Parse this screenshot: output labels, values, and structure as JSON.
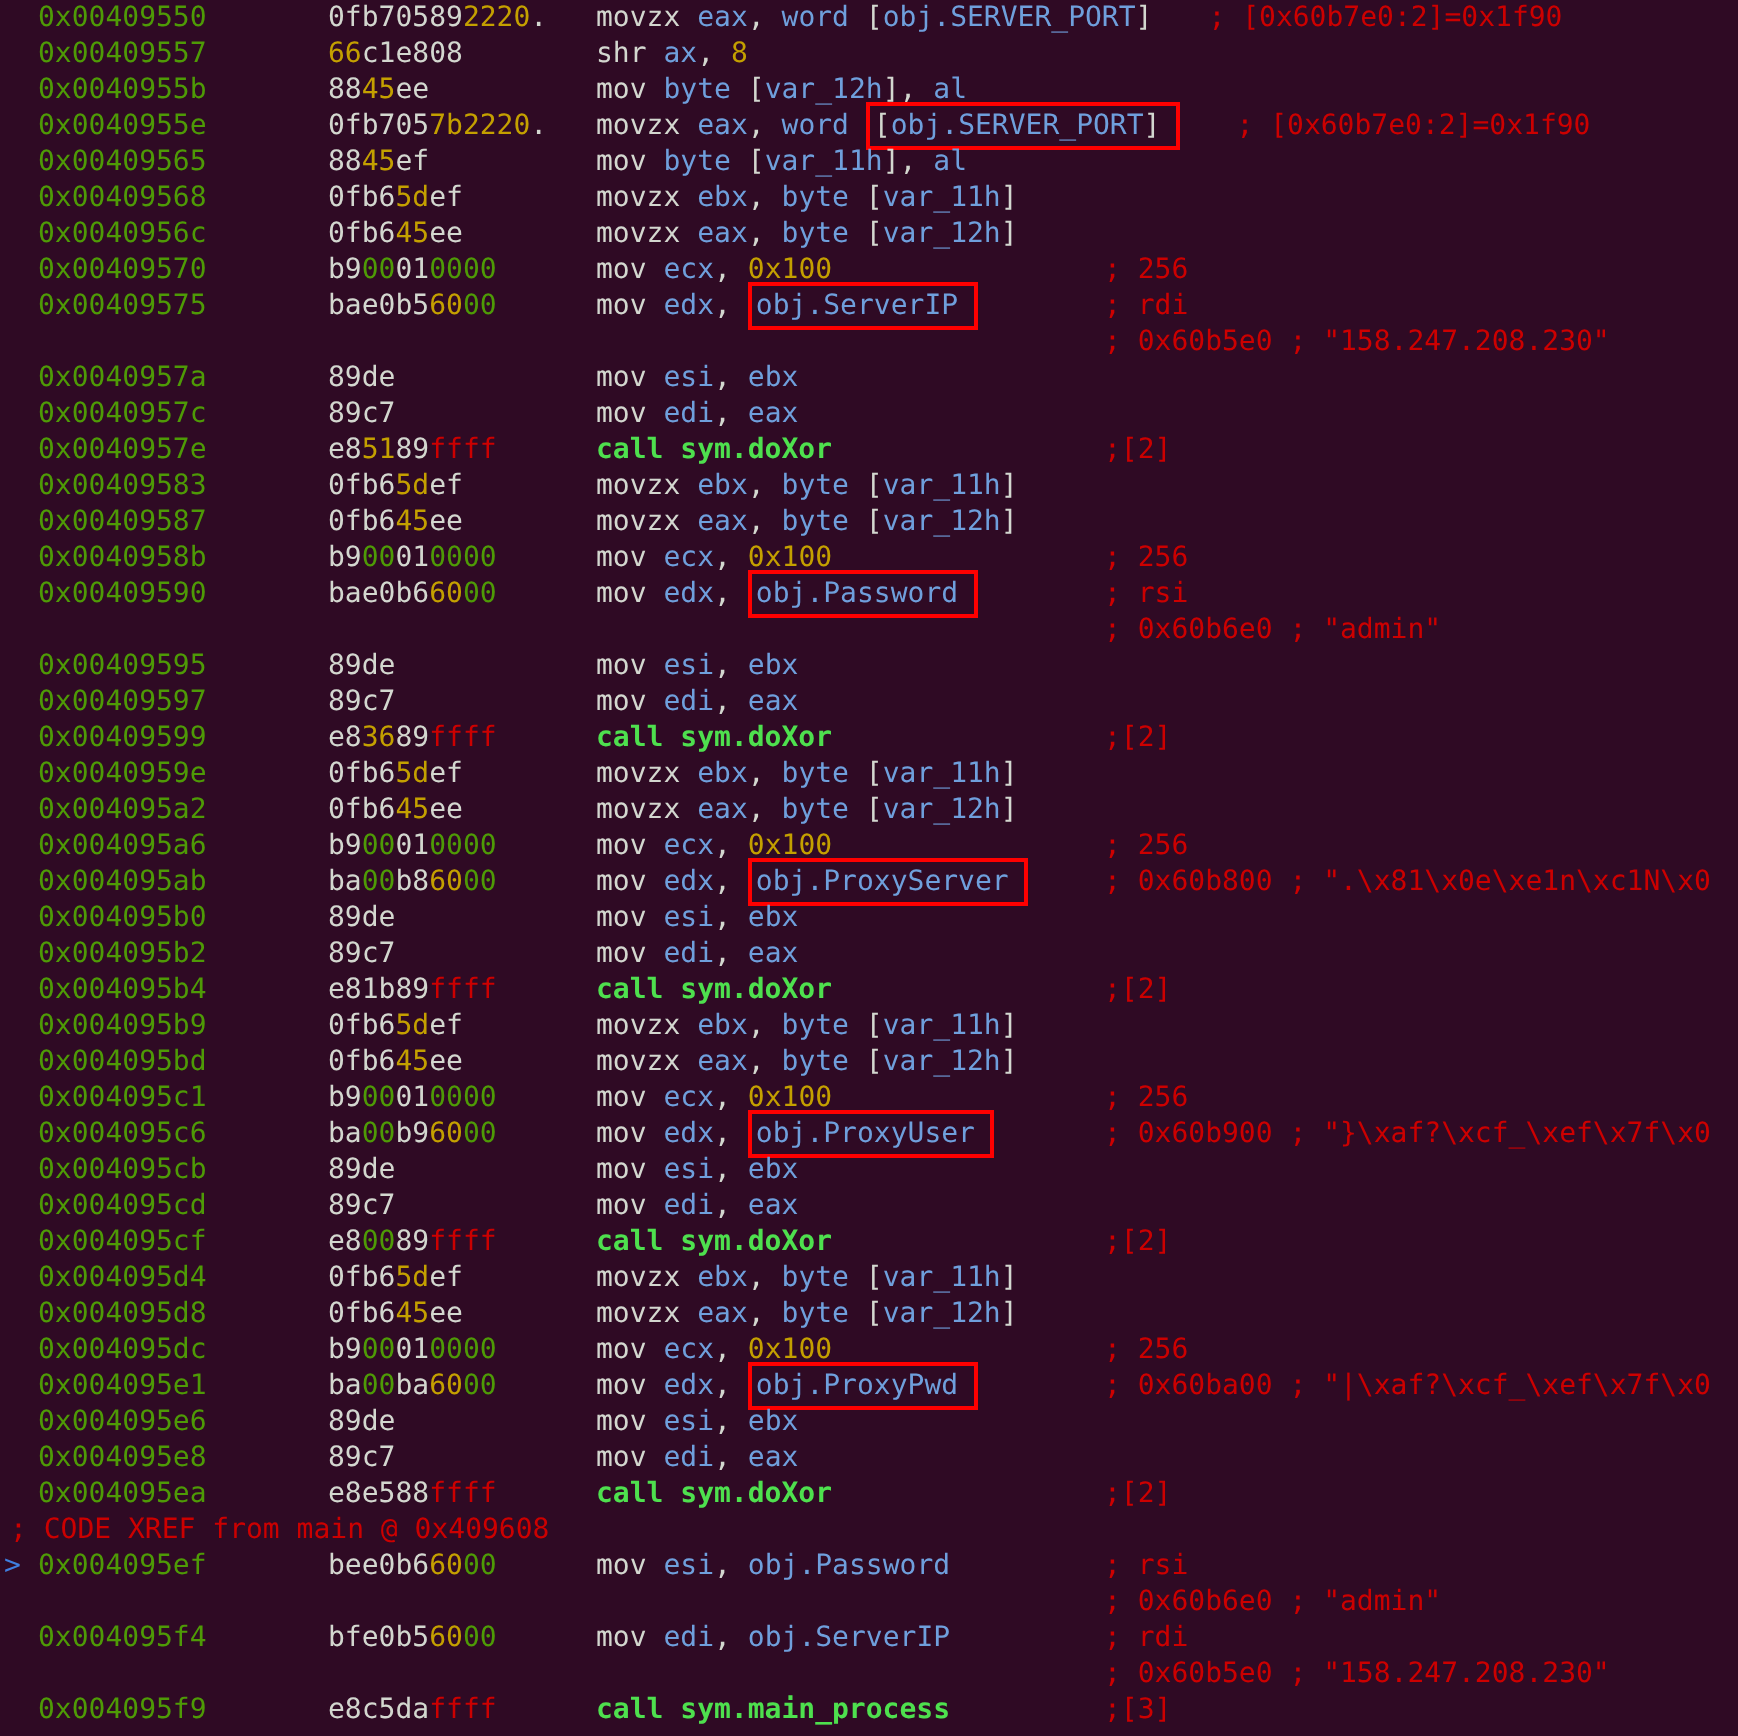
{
  "rows": [
    {
      "kind": "instr",
      "address": "0x00409550",
      "bytes": "0fb705892220.",
      "op": "movzx eax, word [obj.SERVER_PORT]",
      "comment": "; [0x60b7e0:2]=0x1f90"
    },
    {
      "kind": "instr",
      "address": "0x00409557",
      "bytes": "66c1e808",
      "op": "shr ax, 8"
    },
    {
      "kind": "instr",
      "address": "0x0040955b",
      "bytes": "8845ee",
      "op": "mov byte [var_12h], al"
    },
    {
      "kind": "instr",
      "address": "0x0040955e",
      "bytes": "0fb7057b2220.",
      "op": "movzx eax, word ",
      "boxed": "[obj.SERVER_PORT]",
      "comment": "; [0x60b7e0:2]=0x1f90"
    },
    {
      "kind": "instr",
      "address": "0x00409565",
      "bytes": "8845ef",
      "op": "mov byte [var_11h], al"
    },
    {
      "kind": "instr",
      "address": "0x00409568",
      "bytes": "0fb65def",
      "op": "movzx ebx, byte [var_11h]"
    },
    {
      "kind": "instr",
      "address": "0x0040956c",
      "bytes": "0fb645ee",
      "op": "movzx eax, byte [var_12h]"
    },
    {
      "kind": "instr",
      "address": "0x00409570",
      "bytes": "b900010000",
      "op": "mov ecx, 0x100",
      "comment": "; 256"
    },
    {
      "kind": "instr",
      "address": "0x00409575",
      "bytes": "bae0b56000",
      "op": "mov edx, ",
      "boxed": "obj.ServerIP",
      "comment": "; rdi"
    },
    {
      "kind": "comment",
      "comment": "; 0x60b5e0 ; \"158.247.208.230\""
    },
    {
      "kind": "instr",
      "address": "0x0040957a",
      "bytes": "89de",
      "op": "mov esi, ebx"
    },
    {
      "kind": "instr",
      "address": "0x0040957c",
      "bytes": "89c7",
      "op": "mov edi, eax"
    },
    {
      "kind": "call",
      "address": "0x0040957e",
      "bytes": "e85189ffff",
      "op": "call sym.doXor",
      "comment": ";[2]"
    },
    {
      "kind": "instr",
      "address": "0x00409583",
      "bytes": "0fb65def",
      "op": "movzx ebx, byte [var_11h]"
    },
    {
      "kind": "instr",
      "address": "0x00409587",
      "bytes": "0fb645ee",
      "op": "movzx eax, byte [var_12h]"
    },
    {
      "kind": "instr",
      "address": "0x0040958b",
      "bytes": "b900010000",
      "op": "mov ecx, 0x100",
      "comment": "; 256"
    },
    {
      "kind": "instr",
      "address": "0x00409590",
      "bytes": "bae0b66000",
      "op": "mov edx, ",
      "boxed": "obj.Password",
      "comment": "; rsi"
    },
    {
      "kind": "comment",
      "comment": "; 0x60b6e0 ; \"admin\""
    },
    {
      "kind": "instr",
      "address": "0x00409595",
      "bytes": "89de",
      "op": "mov esi, ebx"
    },
    {
      "kind": "instr",
      "address": "0x00409597",
      "bytes": "89c7",
      "op": "mov edi, eax"
    },
    {
      "kind": "call",
      "address": "0x00409599",
      "bytes": "e83689ffff",
      "op": "call sym.doXor",
      "comment": ";[2]"
    },
    {
      "kind": "instr",
      "address": "0x0040959e",
      "bytes": "0fb65def",
      "op": "movzx ebx, byte [var_11h]"
    },
    {
      "kind": "instr",
      "address": "0x004095a2",
      "bytes": "0fb645ee",
      "op": "movzx eax, byte [var_12h]"
    },
    {
      "kind": "instr",
      "address": "0x004095a6",
      "bytes": "b900010000",
      "op": "mov ecx, 0x100",
      "comment": "; 256"
    },
    {
      "kind": "instr",
      "address": "0x004095ab",
      "bytes": "ba00b86000",
      "op": "mov edx, ",
      "boxed": "obj.ProxyServer",
      "comment": "; 0x60b800 ; \".\\x81\\x0e\\xe1n\\xc1N\\x0"
    },
    {
      "kind": "instr",
      "address": "0x004095b0",
      "bytes": "89de",
      "op": "mov esi, ebx"
    },
    {
      "kind": "instr",
      "address": "0x004095b2",
      "bytes": "89c7",
      "op": "mov edi, eax"
    },
    {
      "kind": "call",
      "address": "0x004095b4",
      "bytes": "e81b89ffff",
      "op": "call sym.doXor",
      "comment": ";[2]"
    },
    {
      "kind": "instr",
      "address": "0x004095b9",
      "bytes": "0fb65def",
      "op": "movzx ebx, byte [var_11h]"
    },
    {
      "kind": "instr",
      "address": "0x004095bd",
      "bytes": "0fb645ee",
      "op": "movzx eax, byte [var_12h]"
    },
    {
      "kind": "instr",
      "address": "0x004095c1",
      "bytes": "b900010000",
      "op": "mov ecx, 0x100",
      "comment": "; 256"
    },
    {
      "kind": "instr",
      "address": "0x004095c6",
      "bytes": "ba00b96000",
      "op": "mov edx, ",
      "boxed": "obj.ProxyUser",
      "comment": "; 0x60b900 ; \"}\\xaf?\\xcf_\\xef\\x7f\\x0"
    },
    {
      "kind": "instr",
      "address": "0x004095cb",
      "bytes": "89de",
      "op": "mov esi, ebx"
    },
    {
      "kind": "instr",
      "address": "0x004095cd",
      "bytes": "89c7",
      "op": "mov edi, eax"
    },
    {
      "kind": "call",
      "address": "0x004095cf",
      "bytes": "e80089ffff",
      "op": "call sym.doXor",
      "comment": ";[2]"
    },
    {
      "kind": "instr",
      "address": "0x004095d4",
      "bytes": "0fb65def",
      "op": "movzx ebx, byte [var_11h]"
    },
    {
      "kind": "instr",
      "address": "0x004095d8",
      "bytes": "0fb645ee",
      "op": "movzx eax, byte [var_12h]"
    },
    {
      "kind": "instr",
      "address": "0x004095dc",
      "bytes": "b900010000",
      "op": "mov ecx, 0x100",
      "comment": "; 256"
    },
    {
      "kind": "instr",
      "address": "0x004095e1",
      "bytes": "ba00ba6000",
      "op": "mov edx, ",
      "boxed": "obj.ProxyPwd",
      "comment": "; 0x60ba00 ; \"|\\xaf?\\xcf_\\xef\\x7f\\x0"
    },
    {
      "kind": "instr",
      "address": "0x004095e6",
      "bytes": "89de",
      "op": "mov esi, ebx"
    },
    {
      "kind": "instr",
      "address": "0x004095e8",
      "bytes": "89c7",
      "op": "mov edi, eax"
    },
    {
      "kind": "call",
      "address": "0x004095ea",
      "bytes": "e8e588ffff",
      "op": "call sym.doXor",
      "comment": ";[2]"
    },
    {
      "kind": "xref",
      "comment": "; CODE XREF from main @ 0x409608"
    },
    {
      "kind": "instr",
      "marker": ">",
      "address": "0x004095ef",
      "bytes": "bee0b66000",
      "op": "mov esi, obj.Password",
      "comment": "; rsi"
    },
    {
      "kind": "comment",
      "comment": "; 0x60b6e0 ; \"admin\""
    },
    {
      "kind": "instr",
      "address": "0x004095f4",
      "bytes": "bfe0b56000",
      "op": "mov edi, obj.ServerIP",
      "comment": "; rdi"
    },
    {
      "kind": "comment",
      "comment": "; 0x60b5e0 ; \"158.247.208.230\""
    },
    {
      "kind": "call",
      "address": "0x004095f9",
      "bytes": "e8c5daffff",
      "op": "call sym.main_process",
      "comment": ";[3]"
    }
  ]
}
